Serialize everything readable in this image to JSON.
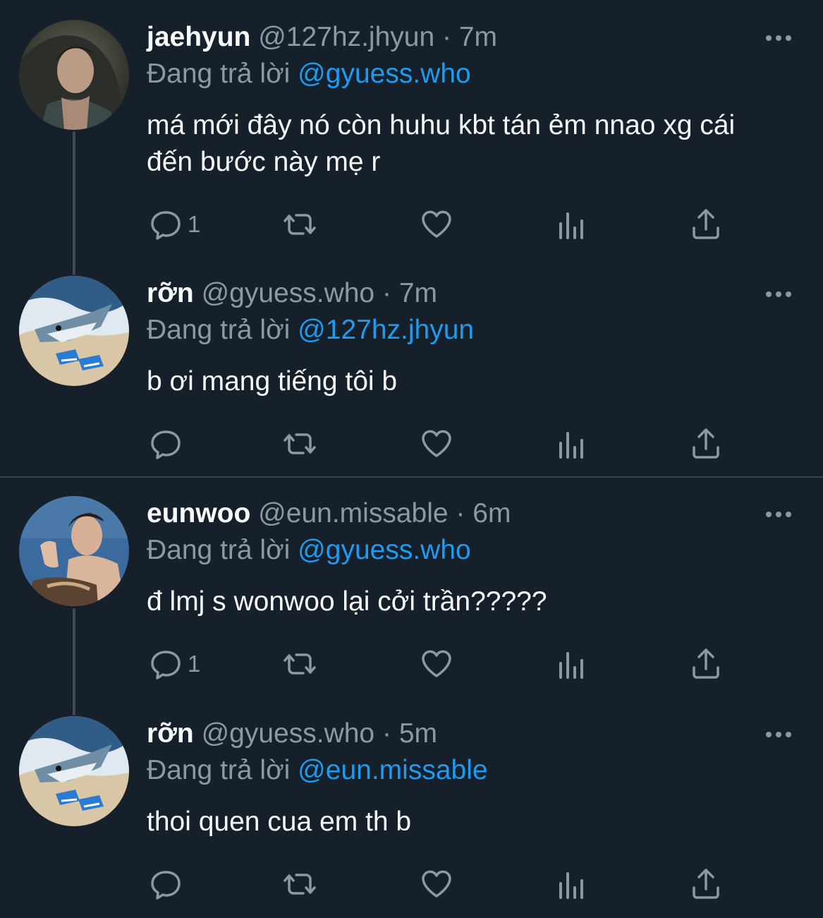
{
  "tweets": [
    {
      "name": "jaehyun",
      "handle": "@127hz.jhyun",
      "sep": "·",
      "time": "7m",
      "reply_prefix": "Đang trả lời",
      "reply_to": "@gyuess.who",
      "text": "má mới đây nó còn huhu kbt tán ẻm nnao xg cái đến bước này mẹ r",
      "reply_count": "1"
    },
    {
      "name": "rỡn",
      "handle": "@gyuess.who",
      "sep": "·",
      "time": "7m",
      "reply_prefix": "Đang trả lời",
      "reply_to": "@127hz.jhyun",
      "text": "b ơi mang tiếng tôi b",
      "reply_count": ""
    },
    {
      "name": "eunwoo",
      "handle": "@eun.missable",
      "sep": "·",
      "time": "6m",
      "reply_prefix": "Đang trả lời",
      "reply_to": "@gyuess.who",
      "text": "đ lmj s wonwoo lại cởi trần?????",
      "reply_count": "1"
    },
    {
      "name": "rỡn",
      "handle": "@gyuess.who",
      "sep": "·",
      "time": "5m",
      "reply_prefix": "Đang trả lời",
      "reply_to": "@eun.missable",
      "text": "thoi quen cua em th b",
      "reply_count": ""
    }
  ],
  "icons": {
    "reply": "reply-icon",
    "retweet": "retweet-icon",
    "like": "heart-icon",
    "views": "views-icon",
    "share": "share-icon",
    "more": "more-icon"
  },
  "colors": {
    "background": "#15202b",
    "text": "#f7f9f9",
    "muted": "#8b98a5",
    "link": "#1d9bf0",
    "thread_line": "#3d4a57",
    "divider": "#38444d"
  }
}
